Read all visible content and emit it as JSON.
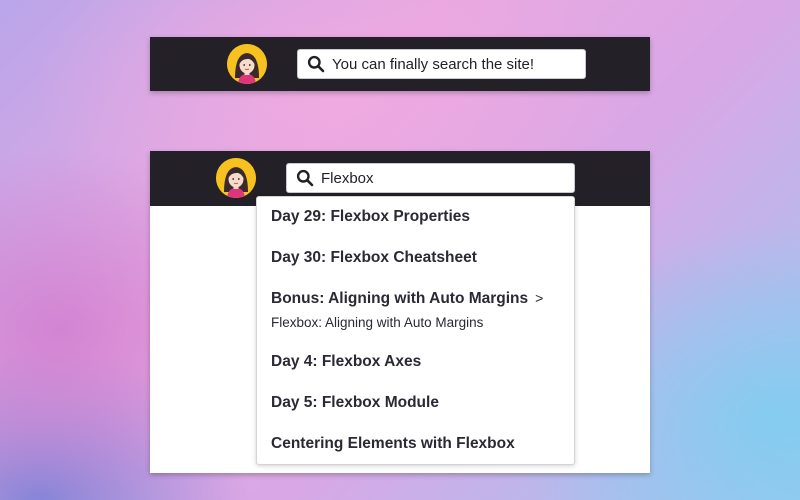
{
  "colors": {
    "navbar_bg": "#232127",
    "avatar_bg": "#f7c21f",
    "text": "#2b2933"
  },
  "top_example": {
    "search": {
      "icon": "search-icon",
      "value": "You can finally search the site!"
    }
  },
  "bottom_example": {
    "search": {
      "icon": "search-icon",
      "value": "Flexbox"
    },
    "results": [
      {
        "title": "Day 29: Flexbox Properties"
      },
      {
        "title": "Day 30: Flexbox Cheatsheet"
      },
      {
        "title": "Bonus: Aligning with Auto Margins",
        "separator": ">",
        "subtitle": "Flexbox: Aligning with Auto Margins"
      },
      {
        "title": "Day 4: Flexbox Axes"
      },
      {
        "title": "Day 5: Flexbox Module"
      },
      {
        "title": "Centering Elements with Flexbox"
      }
    ]
  }
}
